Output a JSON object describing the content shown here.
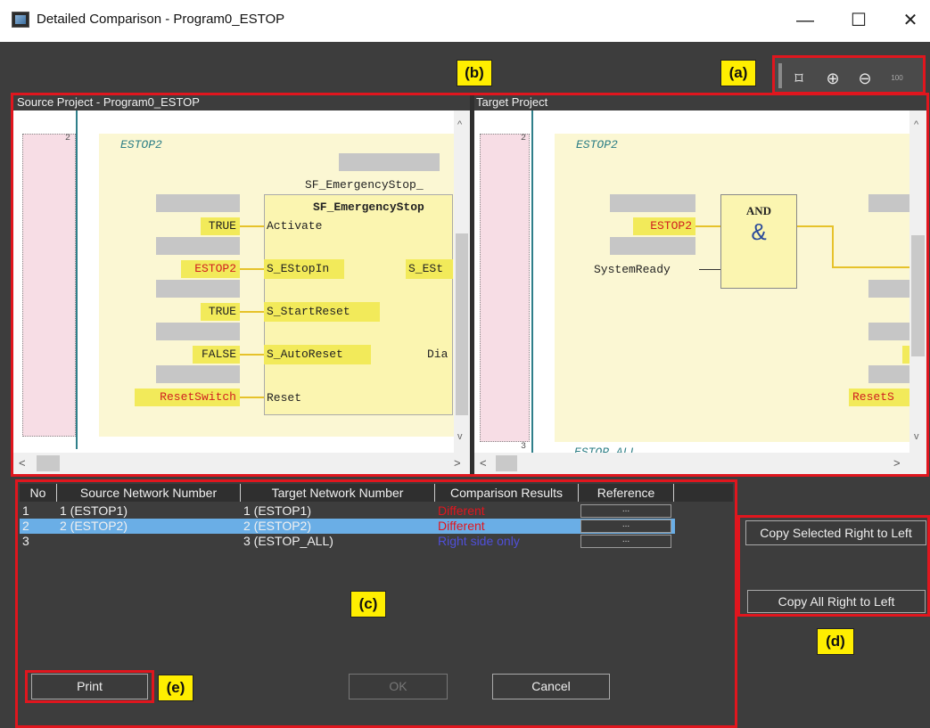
{
  "window": {
    "title": "Detailed Comparison - Program0_ESTOP",
    "minimize": "—",
    "maximize": "☐",
    "close": "✕"
  },
  "toolbar": {
    "icons": [
      "fit-to-window-icon",
      "zoom-in-icon",
      "zoom-out-icon",
      "zoom-100-icon"
    ],
    "fit_glyph": "⌑",
    "zoom_in_glyph": "⊕",
    "zoom_out_glyph": "⊖",
    "zoom_100_glyph": "100"
  },
  "labels": {
    "a": "(a)",
    "b": "(b)",
    "c": "(c)",
    "d": "(d)",
    "e": "(e)"
  },
  "source": {
    "header": "Source Project - Program0_ESTOP",
    "network_no": "2",
    "network_name": "ESTOP2",
    "instance_name": "SF_EmergencyStop_",
    "fb_type": "SF_EmergencyStop",
    "inputs": [
      {
        "var": "TRUE",
        "pin": "Activate",
        "var_red": false
      },
      {
        "var": "ESTOP2",
        "pin": "S_EStopIn",
        "var_red": true
      },
      {
        "var": "TRUE",
        "pin": "S_StartReset",
        "var_red": false
      },
      {
        "var": "FALSE",
        "pin": "S_AutoReset",
        "var_red": false
      },
      {
        "var": "ResetSwitch",
        "pin": "Reset",
        "var_red": true
      }
    ],
    "out_pin_1": "S_ESt",
    "out_pin_2": "Dia"
  },
  "target": {
    "header": "Target Project",
    "network_no": "2",
    "network_no_next": "3",
    "network_name": "ESTOP2",
    "next_network_partial": "ESTOP_ALL",
    "block_type": "AND",
    "block_symbol": "&",
    "input_var": "ESTOP2",
    "input_2": "SystemReady",
    "partial_var": "ResetS"
  },
  "table": {
    "headers": [
      "No",
      "Source Network Number",
      "Target Network Number",
      "Comparison Results",
      "Reference"
    ],
    "rows": [
      {
        "no": "1",
        "source": "1 (ESTOP1)",
        "target": "1 (ESTOP1)",
        "result": "Different",
        "result_color": "#e0161e",
        "ref": "...",
        "selected": false
      },
      {
        "no": "2",
        "source": "2 (ESTOP2)",
        "target": "2 (ESTOP2)",
        "result": "Different",
        "result_color": "#e0161e",
        "ref": "...",
        "selected": true
      },
      {
        "no": "3",
        "source": "",
        "target": "3 (ESTOP_ALL)",
        "result": "Right side only",
        "result_color": "#4f4fd8",
        "ref": "...",
        "selected": false
      }
    ]
  },
  "buttons": {
    "copy_selected": "Copy Selected Right to Left",
    "copy_all": "Copy All Right to Left",
    "print": "Print",
    "ok": "OK",
    "cancel": "Cancel"
  },
  "colors": {
    "selected_row": "#6aaee6",
    "highlight_red": "#e0161e",
    "label_yellow": "#ffee00"
  }
}
